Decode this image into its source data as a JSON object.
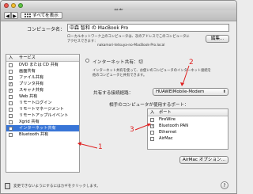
{
  "window": {
    "title": "共有"
  },
  "toolbar": {
    "show_all": "すべてを表示"
  },
  "computer_name": {
    "label": "コンピュータ名：",
    "value": "中森 智和 の MacBook Pro",
    "help_line1": "ローカルネットワーク上のコンピュータは、次のアドレスでこのコンピュータに",
    "help_line2": "アクセスできます：",
    "address": "nakamori-tetsuya-no-MacBook-Pro.local",
    "edit_button": "編集..."
  },
  "services": {
    "header_on": "入",
    "header_service": "サービス",
    "items": [
      {
        "label": "DVD または CD 共有",
        "checked": false
      },
      {
        "label": "画面共有",
        "checked": false
      },
      {
        "label": "ファイル共有",
        "checked": false
      },
      {
        "label": "プリンタ共有",
        "checked": true
      },
      {
        "label": "スキャナ共有",
        "checked": true
      },
      {
        "label": "Web 共有",
        "checked": false
      },
      {
        "label": "リモートログイン",
        "checked": false
      },
      {
        "label": "リモートマネージメント",
        "checked": false
      },
      {
        "label": "リモートアップルイベント",
        "checked": false
      },
      {
        "label": "Xgrid 共有",
        "checked": false
      },
      {
        "label": "インターネット共有",
        "checked": false,
        "selected": true
      },
      {
        "label": "Bluetooth 共有",
        "checked": false
      }
    ]
  },
  "internet_sharing": {
    "status": "インターネット共有：切",
    "desc_line1": "インターネット共有を使って、お使いのコンピュータのインターネット接続を",
    "desc_line2": "他のコンピュータと共有できます。",
    "connection_label": "共有する接続経路：",
    "connection_value": "HUAWEIMobile-Modem",
    "ports_label": "相手のコンピュータが使用するポート：",
    "ports_header_on": "入",
    "ports_header_port": "ポート",
    "ports": [
      {
        "label": "FireWire",
        "checked": false
      },
      {
        "label": "Bluetooth PAN",
        "checked": true
      },
      {
        "label": "Ethernet",
        "checked": false
      },
      {
        "label": "AirMac",
        "checked": false
      }
    ],
    "airmac_button": "AirMac オプション..."
  },
  "annotations": {
    "n1": "1",
    "n2": "2",
    "n3": "3"
  },
  "footer": {
    "lock_text": "変更できないようにするにはカギをクリックします。",
    "help": "?"
  }
}
